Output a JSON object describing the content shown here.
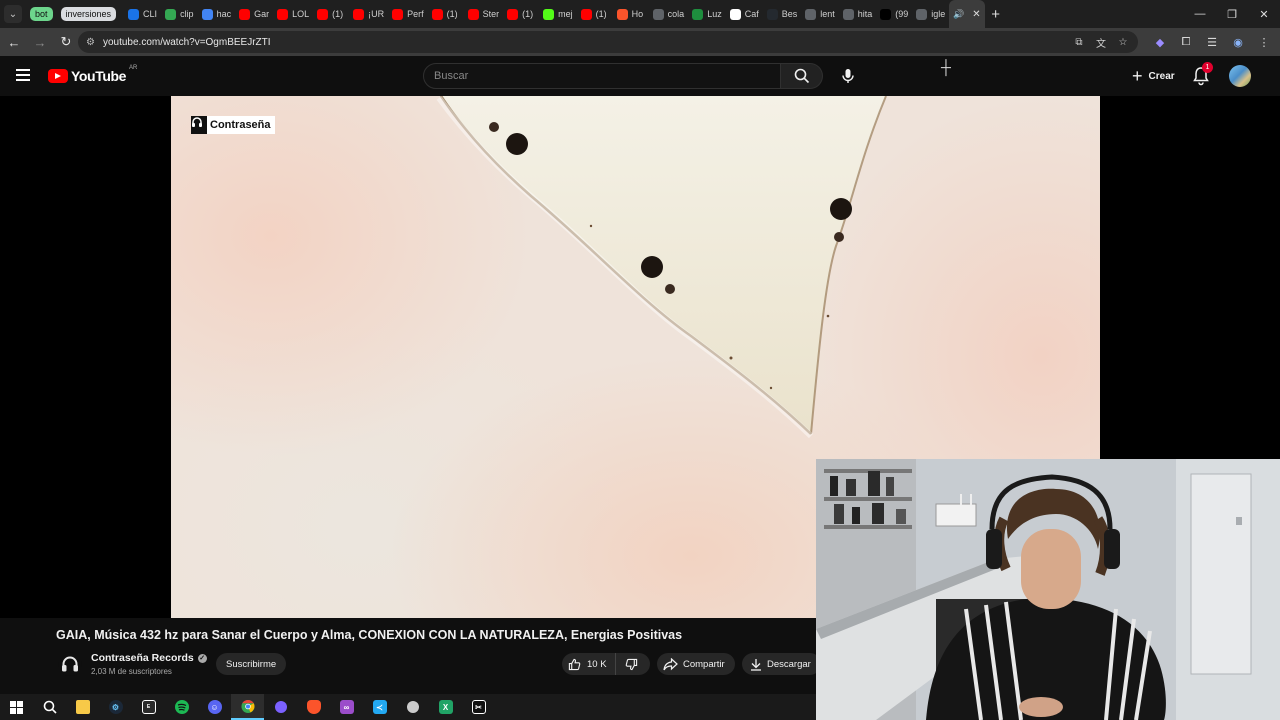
{
  "browser": {
    "tab_groups": [
      {
        "label": "bot",
        "color": "#6dd58c"
      },
      {
        "label": "inversiones",
        "color": "#dadce0"
      }
    ],
    "tabs": [
      {
        "label": "CLI",
        "icon": "google-drive-icon",
        "color": "#1a73e8"
      },
      {
        "label": "clip",
        "icon": "google-drive-icon",
        "color": "#34a853"
      },
      {
        "label": "hac",
        "icon": "google-docs-icon",
        "color": "#4285f4"
      },
      {
        "label": "Gar",
        "icon": "youtube-icon",
        "color": "#ff0000"
      },
      {
        "label": "LOL",
        "icon": "youtube-icon",
        "color": "#ff0000"
      },
      {
        "label": "(1)",
        "icon": "youtube-icon",
        "color": "#ff0000"
      },
      {
        "label": "¡UR",
        "icon": "youtube-icon",
        "color": "#ff0000"
      },
      {
        "label": "Perf",
        "icon": "youtube-icon",
        "color": "#ff0000"
      },
      {
        "label": "(1)",
        "icon": "youtube-icon",
        "color": "#ff0000"
      },
      {
        "label": "Ster",
        "icon": "youtube-icon",
        "color": "#ff0000"
      },
      {
        "label": "(1)",
        "icon": "youtube-icon",
        "color": "#ff0000"
      },
      {
        "label": "mej",
        "icon": "kick-icon",
        "color": "#53fc18"
      },
      {
        "label": "(1)",
        "icon": "youtube-icon",
        "color": "#ff0000"
      },
      {
        "label": "Ho",
        "icon": "brave-icon",
        "color": "#fb542b"
      },
      {
        "label": "cola",
        "icon": "google-icon",
        "color": "#5f6368"
      },
      {
        "label": "Luz",
        "icon": "app-icon",
        "color": "#1e8e3e"
      },
      {
        "label": "Caf",
        "icon": "wikipedia-icon",
        "color": "#ffffff"
      },
      {
        "label": "Bes",
        "icon": "github-icon",
        "color": "#24292f"
      },
      {
        "label": "lent",
        "icon": "google-icon",
        "color": "#5f6368"
      },
      {
        "label": "hita",
        "icon": "google-icon",
        "color": "#5f6368"
      },
      {
        "label": "(99",
        "icon": "tiktok-icon",
        "color": "#000000"
      },
      {
        "label": "igle",
        "icon": "google-icon",
        "color": "#5f6368"
      }
    ],
    "active_tab_label": "(",
    "url": "youtube.com/watch?v=OgmBEEJrZTI"
  },
  "youtube": {
    "logo_text": "YouTube",
    "region": "AR",
    "search_placeholder": "Buscar",
    "create_label": "Crear",
    "notification_count": "1"
  },
  "video": {
    "watermark": "Contraseña",
    "title": "GAIA, Música 432 hz para Sanar el Cuerpo y Alma, CONEXION CON LA NATURALEZA, Energias Positivas",
    "channel_name": "Contraseña Records",
    "subscribers": "2,03 M de suscriptores",
    "subscribe_label": "Suscribirme",
    "likes": "10 K",
    "share_label": "Compartir",
    "download_label": "Descargar"
  },
  "taskbar": {
    "apps": [
      {
        "icon": "windows-start-icon",
        "color": "#ffffff"
      },
      {
        "icon": "search-icon",
        "color": "#ffffff"
      },
      {
        "icon": "file-explorer-icon",
        "color": "#f7c948"
      },
      {
        "icon": "steam-icon",
        "color": "#66c0f4"
      },
      {
        "icon": "epic-games-icon",
        "color": "#ffffff"
      },
      {
        "icon": "spotify-icon",
        "color": "#1db954"
      },
      {
        "icon": "discord-icon",
        "color": "#5865f2"
      },
      {
        "icon": "chrome-icon",
        "color": "#ea4335"
      },
      {
        "icon": "app-icon",
        "color": "#7b61ff"
      },
      {
        "icon": "brave-icon",
        "color": "#fb542b"
      },
      {
        "icon": "visual-studio-icon",
        "color": "#9b4dca"
      },
      {
        "icon": "vscode-icon",
        "color": "#23a9f2"
      },
      {
        "icon": "app-icon",
        "color": "#cccccc"
      },
      {
        "icon": "excel-icon",
        "color": "#21a366"
      },
      {
        "icon": "capcut-icon",
        "color": "#ffffff"
      }
    ]
  }
}
